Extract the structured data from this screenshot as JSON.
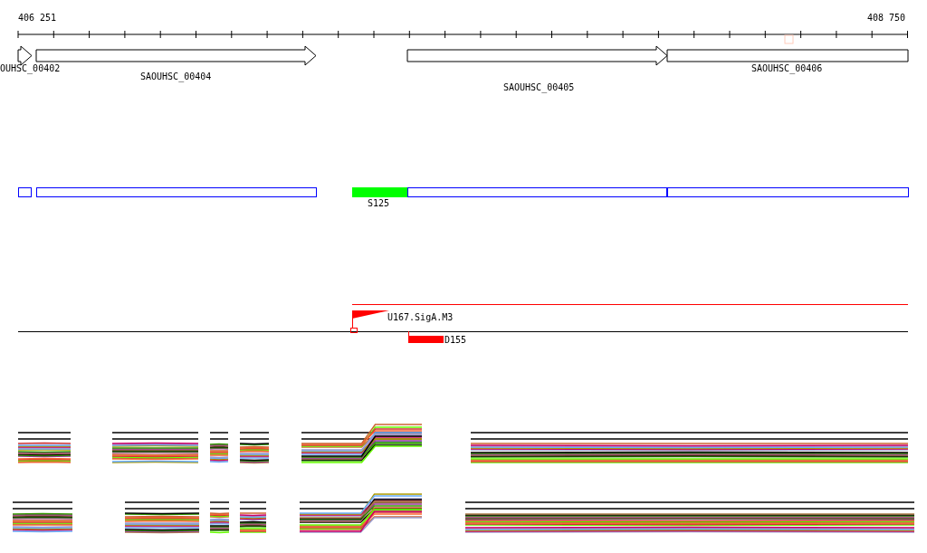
{
  "ruler": {
    "start_label": "406 251",
    "end_label": "408 750"
  },
  "genes": [
    {
      "label": "OUHSC_00402",
      "kind": "arrow"
    },
    {
      "label": "SAOUHSC_00404",
      "kind": "arrow"
    },
    {
      "label": "SAOUHSC_00405",
      "kind": "arrow"
    },
    {
      "label": "SAOUHSC_00406",
      "kind": "box"
    }
  ],
  "segments": [
    {
      "color": "#0000ff"
    },
    {
      "color": "#0000ff"
    },
    {
      "color": "#00ff00",
      "label": "S125"
    },
    {
      "color": "#0000ff"
    },
    {
      "color": "#0000ff"
    }
  ],
  "features": [
    {
      "kind": "flag",
      "label": "U167.SigA.M3"
    },
    {
      "kind": "bar",
      "label": "D155"
    }
  ]
}
